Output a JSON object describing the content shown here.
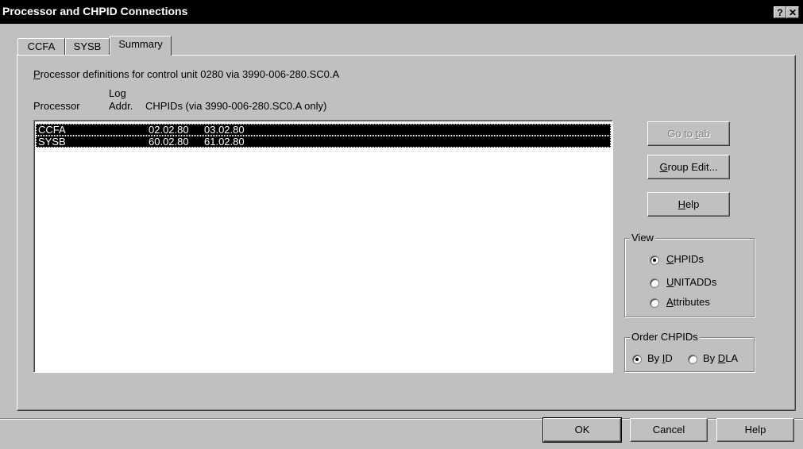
{
  "window": {
    "title": "Processor and CHPID Connections",
    "help_glyph": "?",
    "close_glyph": "✕"
  },
  "tabs": [
    {
      "label": "CCFA"
    },
    {
      "label": "SYSB"
    },
    {
      "label": "Summary",
      "active": true
    }
  ],
  "summary": {
    "description_prefix": "P",
    "description_rest": "rocessor definitions for control unit 0280 via 3990-006-280.SC0.A",
    "col_processor": "Processor",
    "col_log": "Log",
    "col_addr": "Addr.",
    "col_chpids": "CHPIDs (via 3990-006-280.SC0.A only)",
    "rows": [
      {
        "processor": "CCFA",
        "chpid1": "02.02.80",
        "chpid2": "03.02.80"
      },
      {
        "processor": "SYSB",
        "chpid1": "60.02.80",
        "chpid2": "61.02.80"
      }
    ]
  },
  "buttons": {
    "go_to_tab_a": "Go to ",
    "go_to_tab_u": "t",
    "go_to_tab_b": "ab",
    "group_edit_u": "G",
    "group_edit_rest": "roup Edit...",
    "help_u": "H",
    "help_rest": "elp"
  },
  "view_group": {
    "legend": "View",
    "options": [
      {
        "u": "C",
        "rest": "HPIDs",
        "selected": true
      },
      {
        "u": "U",
        "rest": "NITADDs",
        "selected": false
      },
      {
        "u": "A",
        "rest": "ttributes",
        "selected": false
      }
    ]
  },
  "order_group": {
    "legend": "Order CHPIDs",
    "options": [
      {
        "pre": "By ",
        "u": "I",
        "rest": "D",
        "selected": true
      },
      {
        "pre": "By ",
        "u": "D",
        "rest": "LA",
        "selected": false
      }
    ]
  },
  "footer": {
    "ok": "OK",
    "cancel": "Cancel",
    "help": "Help"
  }
}
